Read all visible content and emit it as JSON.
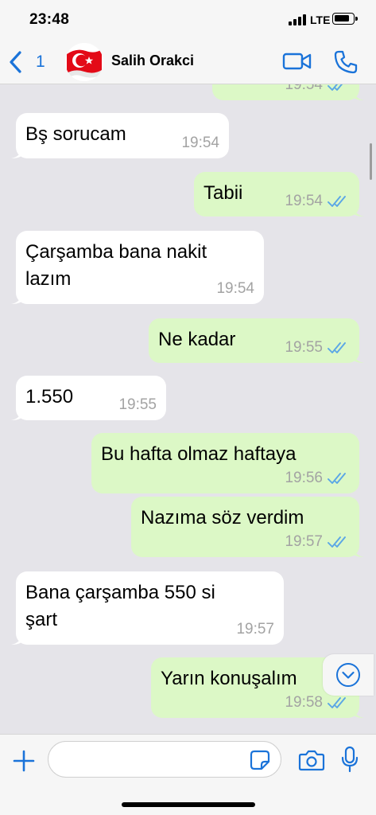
{
  "status_bar": {
    "time": "23:48",
    "network": "LTE"
  },
  "header": {
    "back_count": "1",
    "contact_name": "Salih Orakci"
  },
  "colors": {
    "accent": "#1a73d9",
    "outgoing_bubble": "#dcf8c6",
    "incoming_bubble": "#ffffff",
    "chat_background": "#e5e4e9",
    "read_ticks": "#5aa6e6"
  },
  "messages": [
    {
      "direction": "out",
      "text": "",
      "time": "19:54",
      "status": "read"
    },
    {
      "direction": "in",
      "text": "Bş sorucam",
      "time": "19:54"
    },
    {
      "direction": "out",
      "text": "Tabii",
      "time": "19:54",
      "status": "read"
    },
    {
      "direction": "in",
      "text": "Çarşamba bana nakit\nlazım",
      "time": "19:54"
    },
    {
      "direction": "out",
      "text": "Ne kadar",
      "time": "19:55",
      "status": "read"
    },
    {
      "direction": "in",
      "text": "1.550",
      "time": "19:55"
    },
    {
      "direction": "out",
      "text": "Bu hafta olmaz haftaya",
      "time": "19:56",
      "status": "read"
    },
    {
      "direction": "out",
      "text": "Nazıma söz verdim",
      "time": "19:57",
      "status": "read"
    },
    {
      "direction": "in",
      "text": "Bana çarşamba 550 si\nşart",
      "time": "19:57"
    },
    {
      "direction": "out",
      "text": "Yarın konuşalım",
      "time": "19:58",
      "status": "read"
    }
  ],
  "composer": {
    "placeholder": "",
    "value": ""
  },
  "icons": {
    "back": "chevron-left-icon",
    "video": "video-camera-icon",
    "call": "phone-icon",
    "add": "plus-icon",
    "sticker": "sticker-icon",
    "camera": "camera-icon",
    "microphone": "microphone-icon",
    "scroll_down": "chevron-down-circle-icon"
  }
}
